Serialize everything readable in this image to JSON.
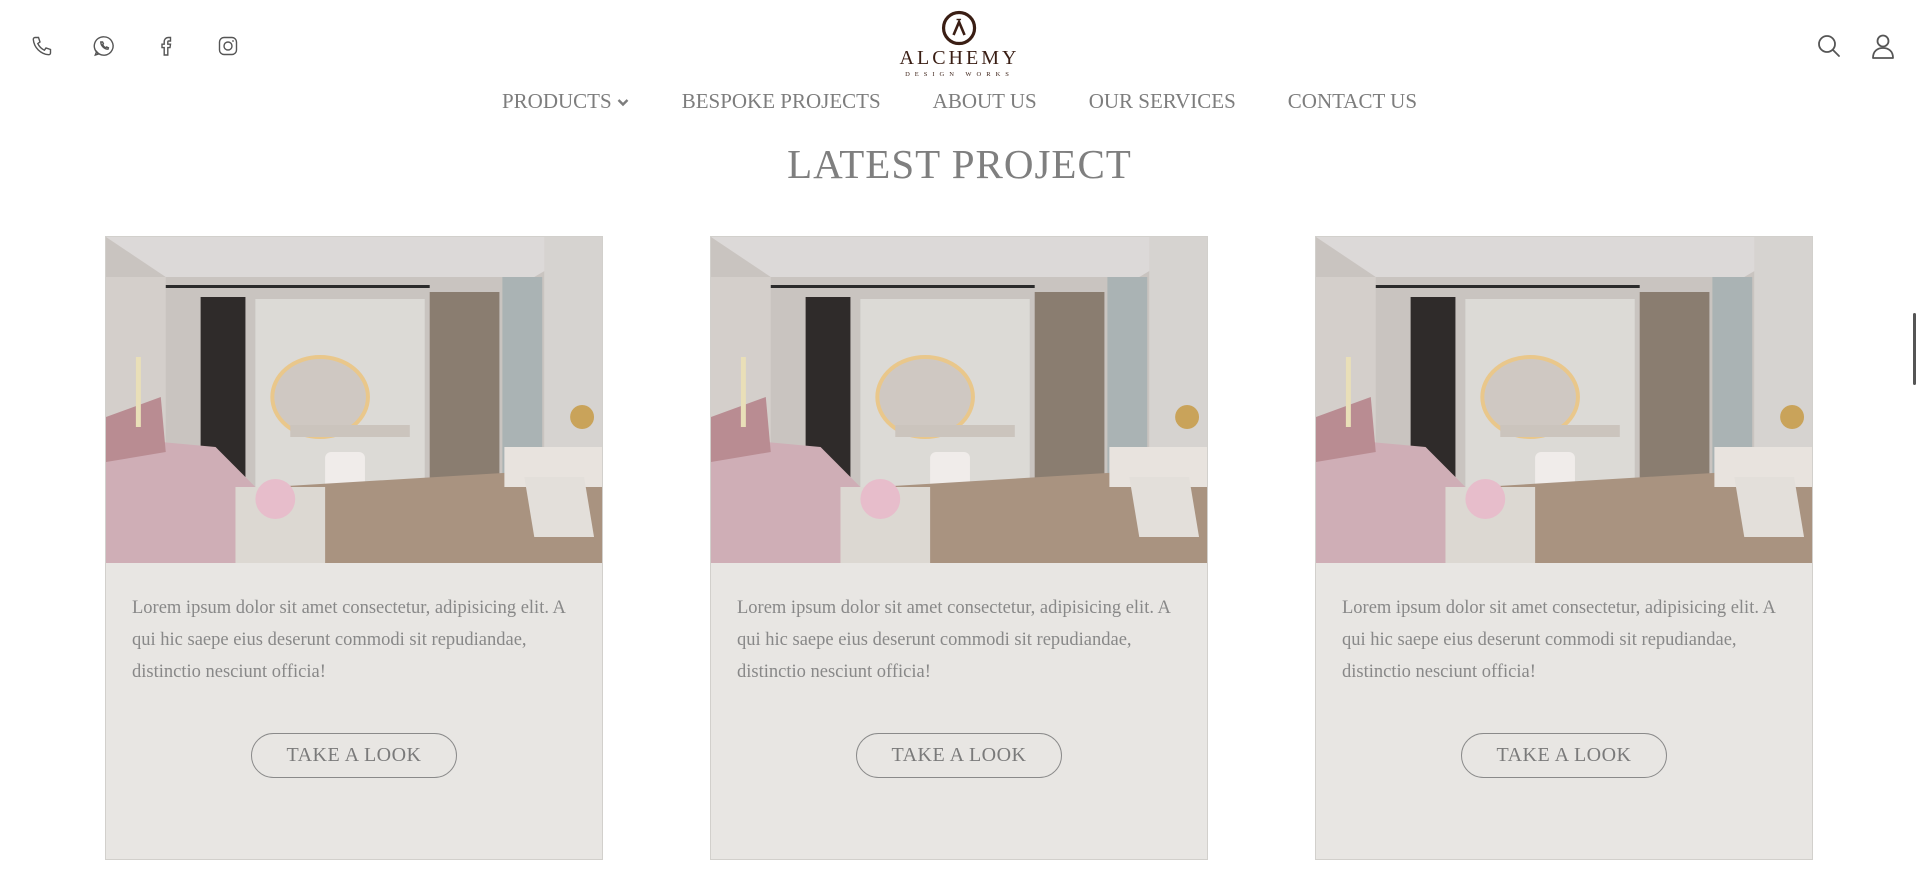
{
  "brand": {
    "name": "ALCHEMY",
    "tagline": "DESIGN WORKS",
    "color": "#3a1e14"
  },
  "header": {
    "social_icons": [
      "phone-icon",
      "whatsapp-icon",
      "facebook-icon",
      "instagram-icon"
    ],
    "right_icons": [
      "search-icon",
      "user-icon"
    ]
  },
  "nav": {
    "items": [
      {
        "label": "PRODUCTS",
        "has_dropdown": true
      },
      {
        "label": "BESPOKE PROJECTS"
      },
      {
        "label": "ABOUT US"
      },
      {
        "label": "OUR SERVICES"
      },
      {
        "label": "CONTACT US"
      }
    ]
  },
  "section": {
    "title": "LATEST PROJECT"
  },
  "cards": [
    {
      "image": "bedroom-photo",
      "text": "Lorem ipsum dolor sit amet consectetur, adipisicing elit. A qui hic saepe eius deserunt commodi sit repudiandae, distinctio nesciunt officia!",
      "button": "TAKE A LOOK"
    },
    {
      "image": "bedroom-photo",
      "text": "Lorem ipsum dolor sit amet consectetur, adipisicing elit. A qui hic saepe eius deserunt commodi sit repudiandae, distinctio nesciunt officia!",
      "button": "TAKE A LOOK"
    },
    {
      "image": "bedroom-photo",
      "text": "Lorem ipsum dolor sit amet consectetur, adipisicing elit. A qui hic saepe eius deserunt commodi sit repudiandae, distinctio nesciunt officia!",
      "button": "TAKE A LOOK"
    }
  ],
  "colors": {
    "card_bg": "#e8e6e3",
    "text": "#7a7a7a"
  }
}
